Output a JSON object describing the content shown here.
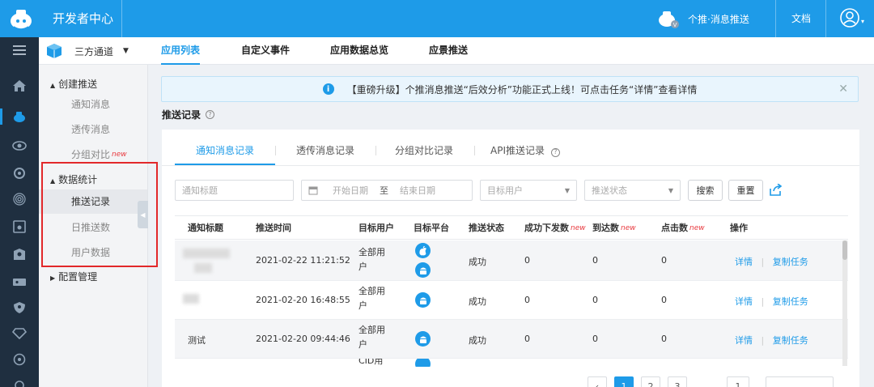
{
  "header": {
    "brand": "开发者中心",
    "app_name": "个推·消息推送",
    "docs": "文档"
  },
  "subheader": {
    "project": "三方通道",
    "tabs": [
      "应用列表",
      "自定义事件",
      "应用数据总览",
      "应景推送"
    ],
    "active_tab": "应用列表"
  },
  "sidebar": {
    "group1": "创建推送",
    "group1_items": [
      "通知消息",
      "透传消息",
      "分组对比"
    ],
    "new_badge": "new",
    "group2": "数据统计",
    "group2_items": [
      "推送记录",
      "日推送数",
      "用户数据"
    ],
    "group3": "配置管理",
    "active_item": "推送记录"
  },
  "notice": {
    "text": "【重磅升级】个推消息推送“后效分析”功能正式上线！可点击任务“详情”查看详情"
  },
  "page": {
    "title": "推送记录"
  },
  "tabs": [
    "通知消息记录",
    "透传消息记录",
    "分组对比记录",
    "API推送记录"
  ],
  "filters": {
    "title_placeholder": "通知标题",
    "start_date": "开始日期",
    "to": "至",
    "end_date": "结束日期",
    "target_user": "目标用户",
    "push_status": "推送状态",
    "search": "搜索",
    "reset": "重置"
  },
  "table": {
    "columns": [
      "通知标题",
      "推送时间",
      "目标用户",
      "目标平台",
      "推送状态",
      "成功下发数",
      "到达数",
      "点击数",
      "操作"
    ],
    "new_label": "new",
    "rows": [
      {
        "title": "",
        "time": "2021-02-22 11:21:52",
        "target": "全部用户",
        "platforms": [
          "apple",
          "android"
        ],
        "status": "成功",
        "delivered": "0",
        "arrived": "0",
        "clicks": "0",
        "detail": "详情",
        "copy": "复制任务"
      },
      {
        "title": "",
        "time": "2021-02-20 16:48:55",
        "target": "全部用户",
        "platforms": [
          "android"
        ],
        "status": "成功",
        "delivered": "0",
        "arrived": "0",
        "clicks": "0",
        "detail": "详情",
        "copy": "复制任务"
      },
      {
        "title": "测试",
        "time": "2021-02-20 09:44:46",
        "target": "全部用户",
        "platforms": [
          "android"
        ],
        "status": "成功",
        "delivered": "0",
        "arrived": "0",
        "clicks": "0",
        "detail": "详情",
        "copy": "复制任务"
      },
      {
        "title": "",
        "time": "",
        "target": "CID用",
        "platforms": [
          "android"
        ],
        "status": "",
        "delivered": "",
        "arrived": "",
        "clicks": "",
        "detail": "",
        "copy": ""
      }
    ]
  },
  "pagination": {
    "current": "1",
    "pages": [
      "1",
      "2",
      "3"
    ]
  },
  "colors": {
    "primary": "#1e9be8",
    "sidebar_dark": "#1f2f40",
    "highlight_box": "#e2282a",
    "new_badge": "#e8393e"
  }
}
